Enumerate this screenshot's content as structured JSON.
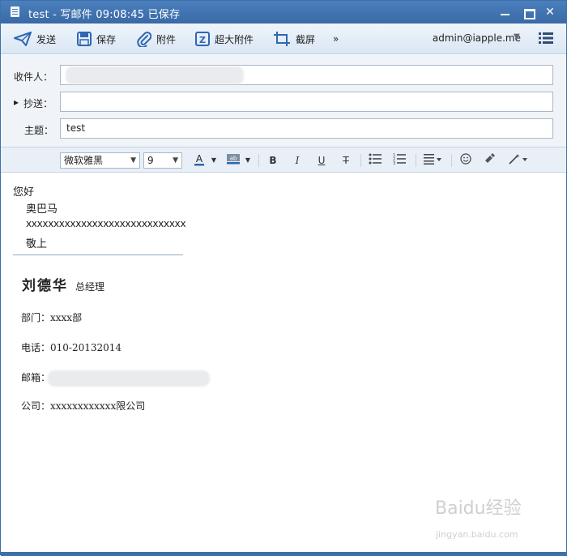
{
  "window": {
    "title": "test - 写邮件   09:08:45 已保存"
  },
  "toolbar": {
    "send_label": "发送",
    "save_label": "保存",
    "attach_label": "附件",
    "bigattach_label": "超大附件",
    "screenshot_label": "截屏",
    "more_label": "»",
    "account": "admin@iapple.me"
  },
  "fields": {
    "to_label": "收件人：",
    "cc_label": "抄送：",
    "subject_label": "主题：",
    "subject_value": "test",
    "to_value": "",
    "cc_value": ""
  },
  "format": {
    "font_family": "微软雅黑",
    "font_size": "9",
    "bold": "B",
    "italic": "I",
    "underline": "U",
    "strike": "T"
  },
  "body": {
    "greeting": "您好",
    "recipient": "奥巴马",
    "content": "xxxxxxxxxxxxxxxxxxxxxxxxxxxxx",
    "closing": "敬上"
  },
  "signature": {
    "name": "刘德华",
    "title": "总经理",
    "dept": "部门：xxxx部",
    "phone": "电话：010-20132014",
    "email": "邮箱：",
    "company": "公司：xxxxxxxxxxxx限公司"
  },
  "watermark": {
    "brand": "Baidu经验",
    "url": "jingyan.baidu.com"
  },
  "colors": {
    "titlebar": "#3a6aa6",
    "accent": "#2f66b3"
  }
}
